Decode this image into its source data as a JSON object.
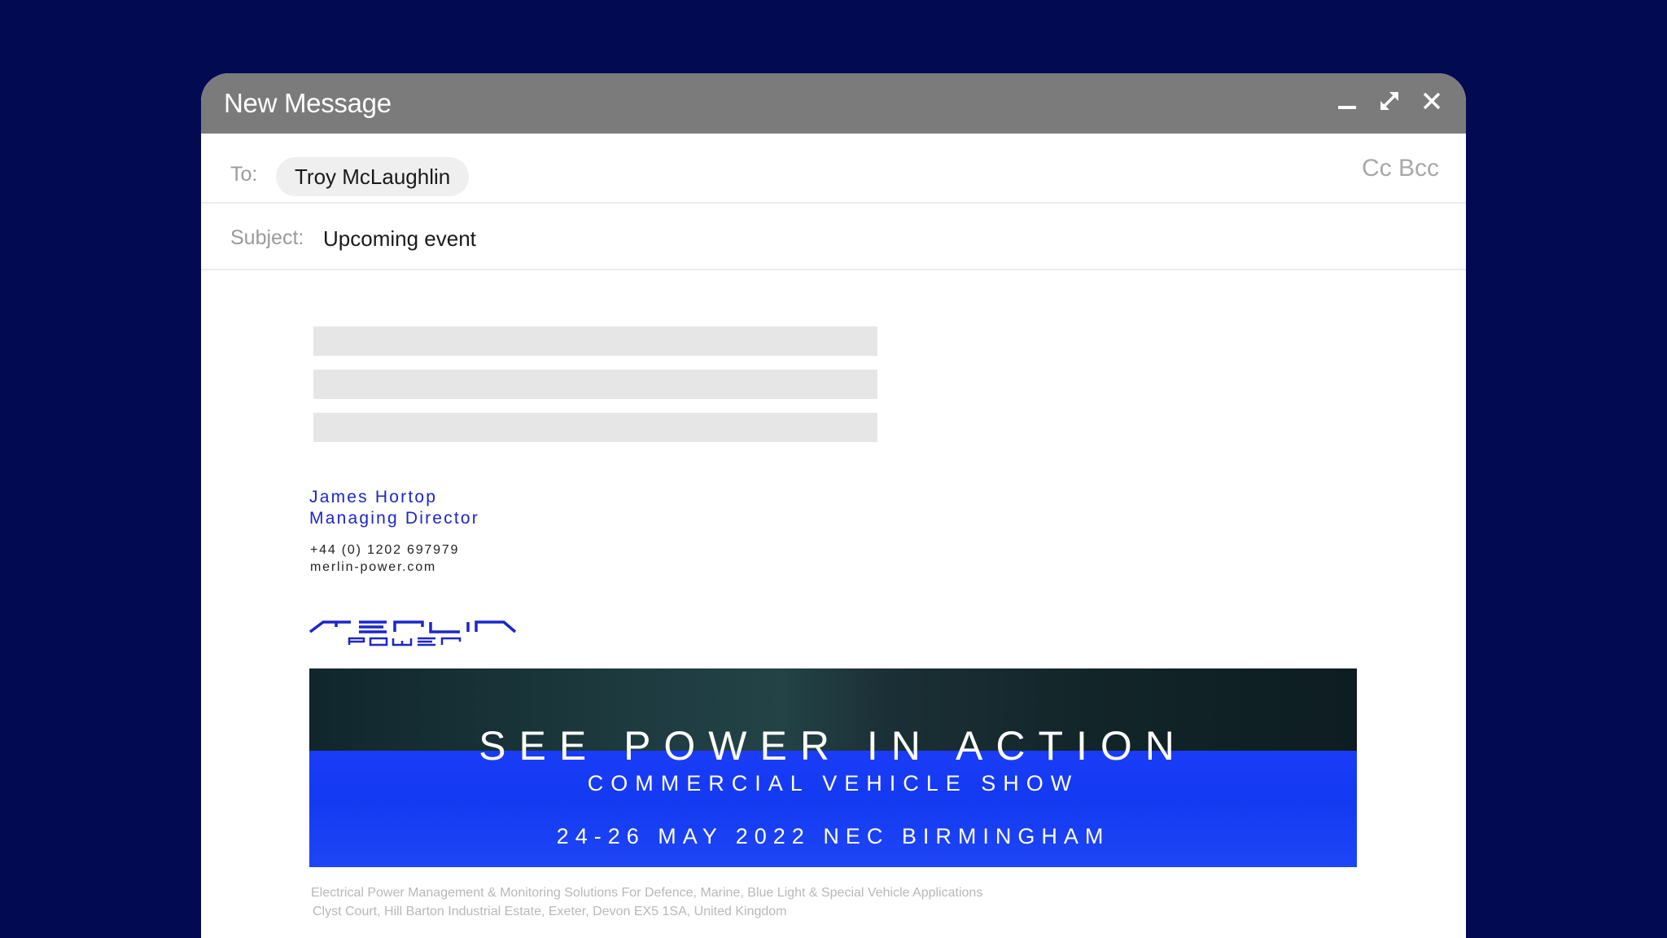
{
  "window": {
    "title": "New Message"
  },
  "to": {
    "label": "To:",
    "recipient": "Troy McLaughlin",
    "cc_label": "Cc",
    "bcc_label": "Bcc"
  },
  "subject": {
    "label": "Subject:",
    "value": "Upcoming event"
  },
  "signature": {
    "name": "James Hortop",
    "role": "Managing Director",
    "phone": "+44 (0) 1202 697979",
    "website": "merlin-power.com",
    "logo_text": "MERLIN POWER"
  },
  "banner": {
    "headline": "SEE POWER IN ACTION",
    "subheadline": "COMMERCIAL VEHICLE SHOW",
    "dates": "24-26 MAY 2022 NEC BIRMINGHAM"
  },
  "footer": {
    "line1": "Electrical Power Management & Monitoring Solutions For Defence, Marine, Blue Light & Special Vehicle Applications",
    "line2": "Clyst Court, Hill Barton Industrial Estate, Exeter, Devon EX5 1SA, United Kingdom"
  },
  "icons": {
    "minimize": "minimize-icon",
    "maximize": "expand-icon",
    "close": "close-icon"
  },
  "colors": {
    "background": "#020b52",
    "titlebar": "#7b7b7b",
    "brand_blue": "#1d26c9",
    "banner_blue": "#1737f5"
  }
}
